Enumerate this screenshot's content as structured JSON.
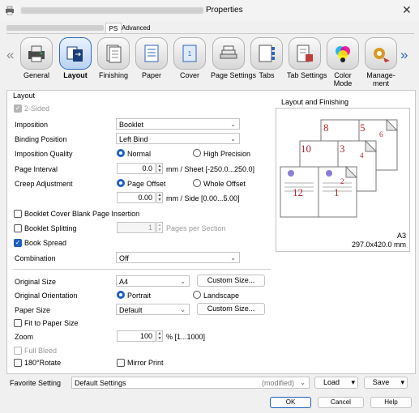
{
  "window": {
    "title": "Properties",
    "close_glyph": "✕"
  },
  "top_tabs": {
    "ps": "PS",
    "advanced": "Advanced"
  },
  "icon_tabs": [
    {
      "label": "General",
      "icon": "printer-icon"
    },
    {
      "label": "Layout",
      "icon": "layout-icon",
      "selected": true
    },
    {
      "label": "Finishing",
      "icon": "finishing-icon"
    },
    {
      "label": "Paper",
      "icon": "paper-icon"
    },
    {
      "label": "Cover",
      "icon": "cover-icon"
    },
    {
      "label": "Page Settings",
      "icon": "page-settings-icon"
    },
    {
      "label": "Tabs",
      "icon": "tabs-icon"
    },
    {
      "label": "Tab Settings",
      "icon": "tab-settings-icon"
    },
    {
      "label": "Color\nMode",
      "icon": "color-mode-icon"
    },
    {
      "label": "Manage-\nment",
      "icon": "management-icon"
    }
  ],
  "layout": {
    "section_title": "Layout",
    "two_sided": "2-Sided",
    "imposition_label": "Imposition",
    "imposition_value": "Booklet",
    "binding_label": "Binding Position",
    "binding_value": "Left Bind",
    "quality_label": "Imposition Quality",
    "quality_normal": "Normal",
    "quality_high": "High Precision",
    "page_interval_label": "Page Interval",
    "page_interval_value": "0.0",
    "page_interval_unit": "mm / Sheet [-250.0...250.0]",
    "creep_label": "Creep Adjustment",
    "creep_page_offset": "Page Offset",
    "creep_whole_offset": "Whole Offset",
    "creep_value": "0.00",
    "creep_unit": "mm / Side [0.00...5.00]",
    "cover_blank": "Booklet Cover Blank Page Insertion",
    "booklet_split": "Booklet Splitting",
    "split_value": "1",
    "split_unit": "Pages per Section",
    "book_spread": "Book Spread",
    "combination_label": "Combination",
    "combination_value": "Off",
    "original_size_label": "Original Size",
    "original_size_value": "A4",
    "custom_size_1": "Custom Size...",
    "orientation_label": "Original Orientation",
    "portrait": "Portrait",
    "landscape": "Landscape",
    "paper_size_label": "Paper Size",
    "paper_size_value": "Default",
    "custom_size_2": "Custom Size...",
    "fit_to_paper": "Fit to Paper Size",
    "zoom_label": "Zoom",
    "zoom_value": "100",
    "zoom_unit": "% [1...1000]",
    "full_bleed": "Full Bleed",
    "rotate": "180°Rotate",
    "mirror": "Mirror Print"
  },
  "preview": {
    "title": "Layout and Finishing",
    "paper": "A3",
    "dimensions": "297.0x420.0 mm",
    "page_numbers": [
      "8",
      "5",
      "6",
      "10",
      "3",
      "4",
      "12",
      "1",
      "2"
    ]
  },
  "footer": {
    "favorite_label": "Favorite Setting",
    "favorite_value": "Default Settings",
    "modified": "(modified)",
    "load": "Load",
    "save": "Save"
  },
  "buttons": {
    "ok": "OK",
    "cancel": "Cancel",
    "help": "Help"
  },
  "colors": {
    "accent": "#1f5fbf",
    "page_number": "#b3262b"
  }
}
